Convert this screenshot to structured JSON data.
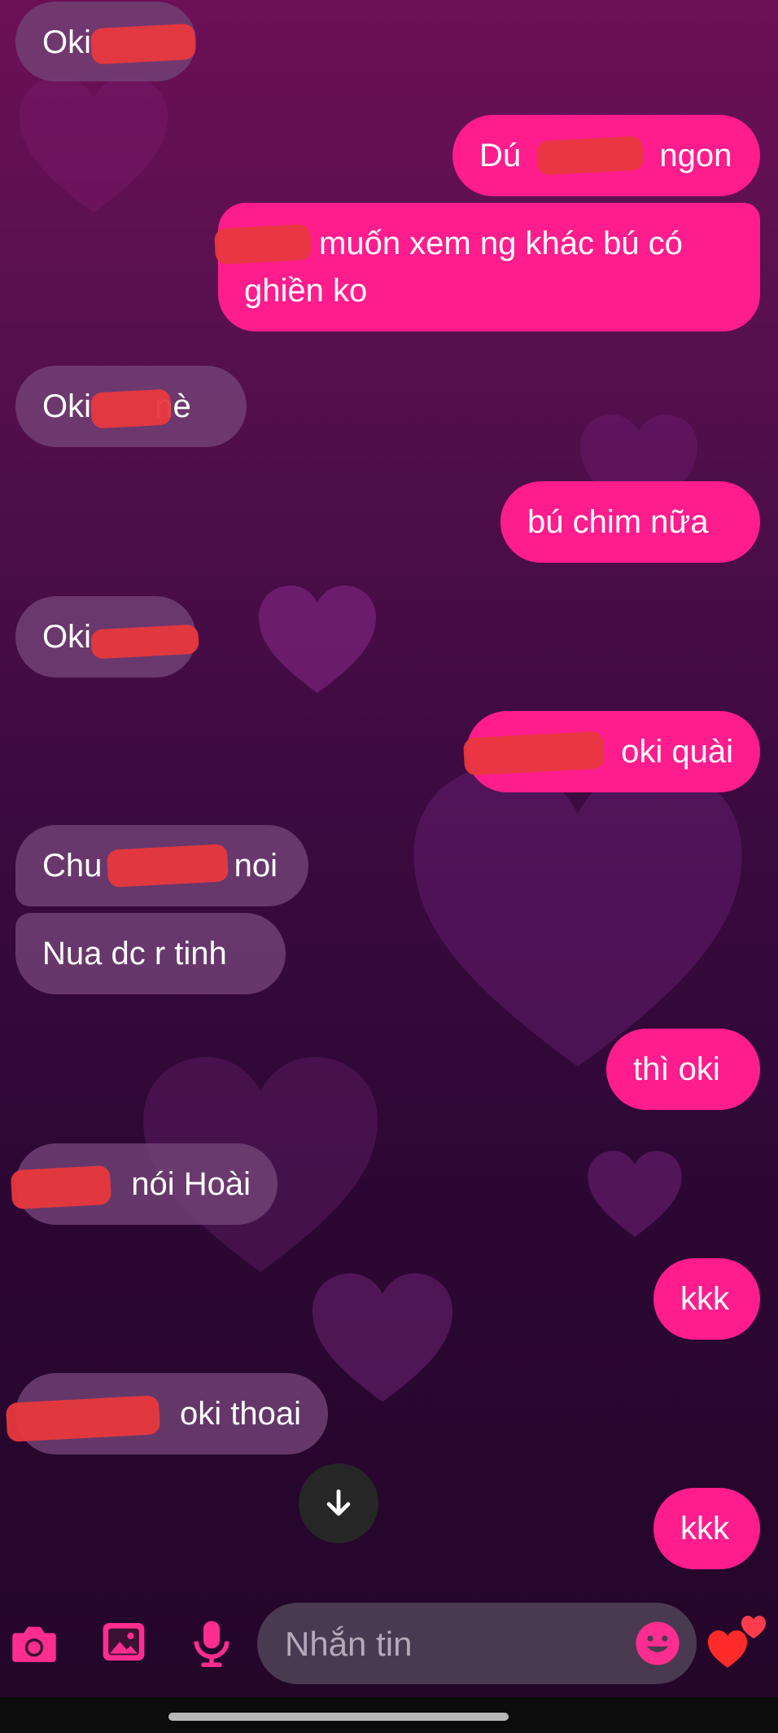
{
  "theme": {
    "incoming_bubble": "#734276",
    "outgoing_bubble": "#ff1c8d",
    "accent_icon": "#ff2d8f",
    "redaction": "#e8383e"
  },
  "messages": [
    {
      "direction": "incoming",
      "text": "Oki"
    },
    {
      "direction": "outgoing",
      "text_before": "Dú",
      "text_after": "ngon"
    },
    {
      "direction": "outgoing",
      "text": "muốn xem ng khác bú có ghiền ko"
    },
    {
      "direction": "incoming",
      "text_before": "Oki",
      "text_after": "nè"
    },
    {
      "direction": "outgoing",
      "text": "bú chim nữa"
    },
    {
      "direction": "incoming",
      "text": "Oki"
    },
    {
      "direction": "outgoing",
      "text": "oki quài"
    },
    {
      "direction": "incoming",
      "text_before": "Chu",
      "text_after": "noi"
    },
    {
      "direction": "incoming",
      "text": "Nua dc r tinh"
    },
    {
      "direction": "outgoing",
      "text": "thì oki"
    },
    {
      "direction": "incoming",
      "text": "nói Hoài"
    },
    {
      "direction": "outgoing",
      "text": "kkk"
    },
    {
      "direction": "incoming",
      "text": "oki thoai"
    },
    {
      "direction": "outgoing",
      "text": "kkk"
    }
  ],
  "scroll_down": {
    "icon": "arrow-down-icon"
  },
  "composer": {
    "placeholder": "Nhắn tin",
    "icons": [
      "camera-icon",
      "image-icon",
      "microphone-icon",
      "emoji-icon",
      "hearts-icon"
    ]
  }
}
